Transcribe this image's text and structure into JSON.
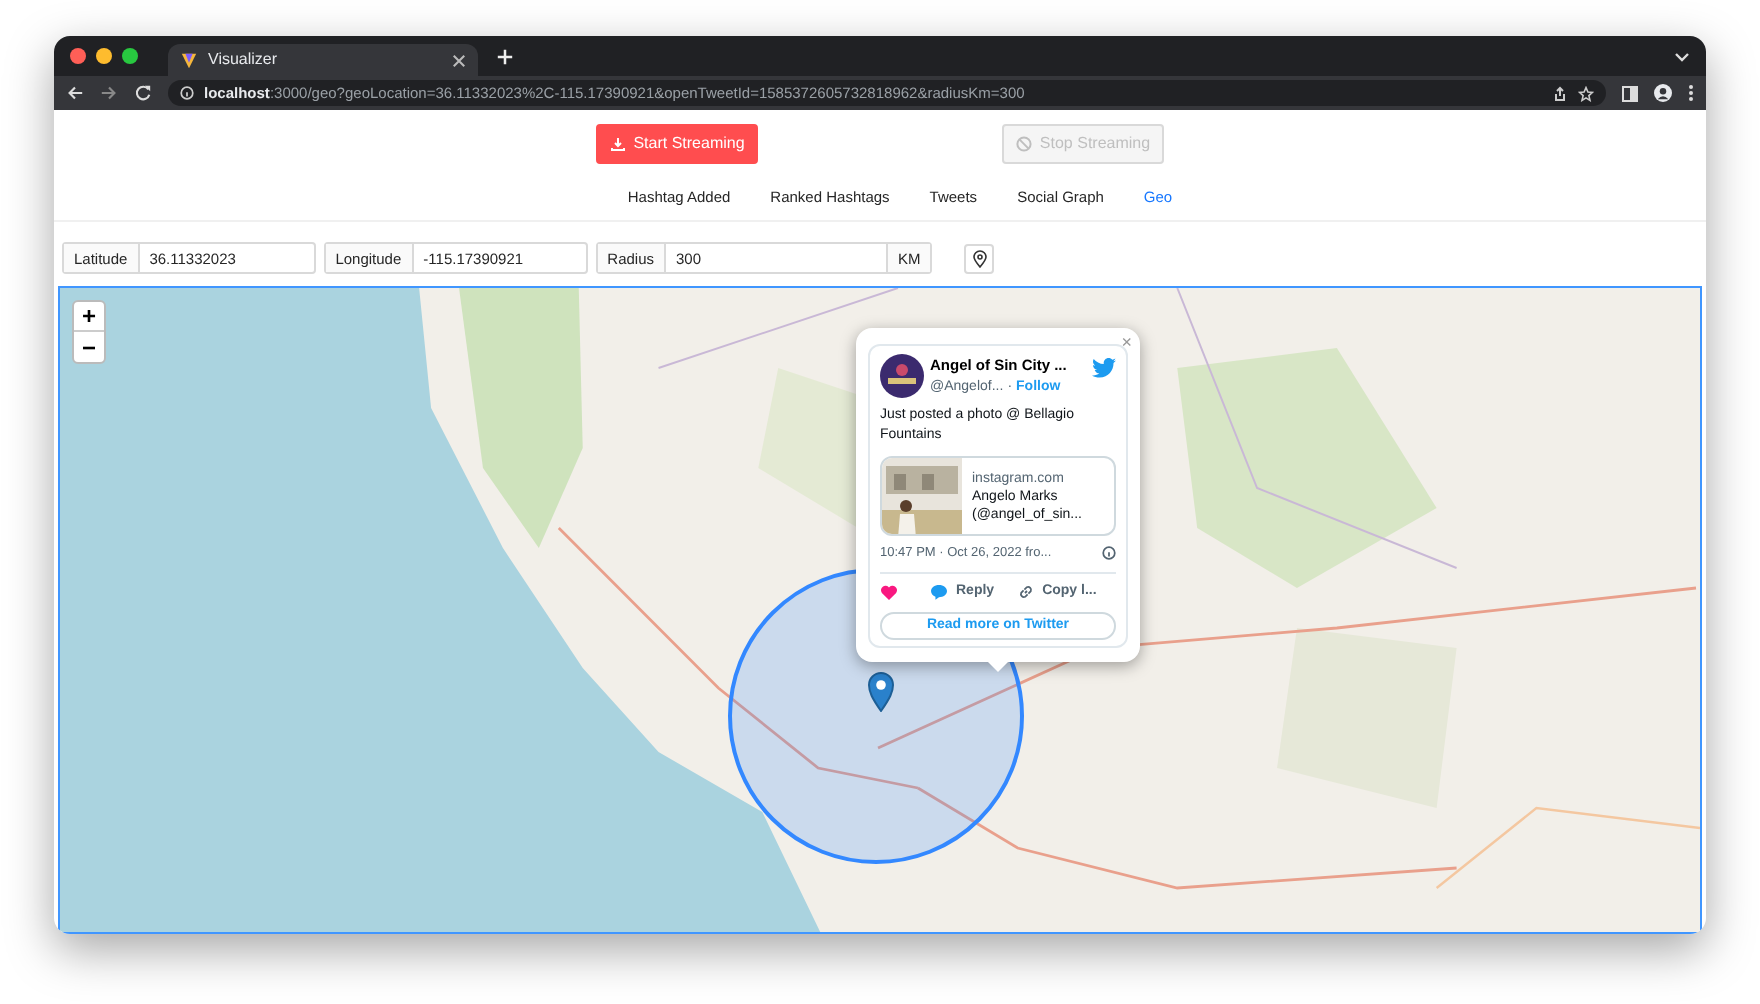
{
  "browser": {
    "tab_title": "Visualizer",
    "url_host": "localhost",
    "url_rest": ":3000/geo?geoLocation=36.11332023%2C-115.17390921&openTweetId=1585372605732818962&radiusKm=300"
  },
  "actions": [
    {
      "label": "Start Streaming",
      "disabled": false
    },
    {
      "label": "Stop Streaming",
      "disabled": true
    }
  ],
  "nav": [
    {
      "label": "Hashtag Added",
      "selected": false
    },
    {
      "label": "Ranked Hashtags",
      "selected": false
    },
    {
      "label": "Tweets",
      "selected": false
    },
    {
      "label": "Social Graph",
      "selected": false
    },
    {
      "label": "Geo",
      "selected": true
    }
  ],
  "inputs": [
    {
      "label": "Latitude",
      "value": "36.11332023"
    },
    {
      "label": "Longitude",
      "value": "-115.17390921"
    },
    {
      "label": "Radius",
      "value": "300",
      "suffix": "KM"
    }
  ],
  "map": {
    "zoom_in": "+",
    "zoom_out": "−",
    "tweet": {
      "close": "×",
      "name": "Angel of Sin City ...",
      "handle": "@Angelof...",
      "separator": "·",
      "follow": "Follow",
      "text": "Just posted a photo @ Bellagio Fountains",
      "link_domain": "instagram.com",
      "link_title": "Angelo Marks (@angel_of_sin...",
      "timestamp": "10:47 PM · Oct 26, 2022 fro...",
      "reply": "Reply",
      "copy": "Copy l...",
      "read_more": "Read more on Twitter"
    }
  }
}
